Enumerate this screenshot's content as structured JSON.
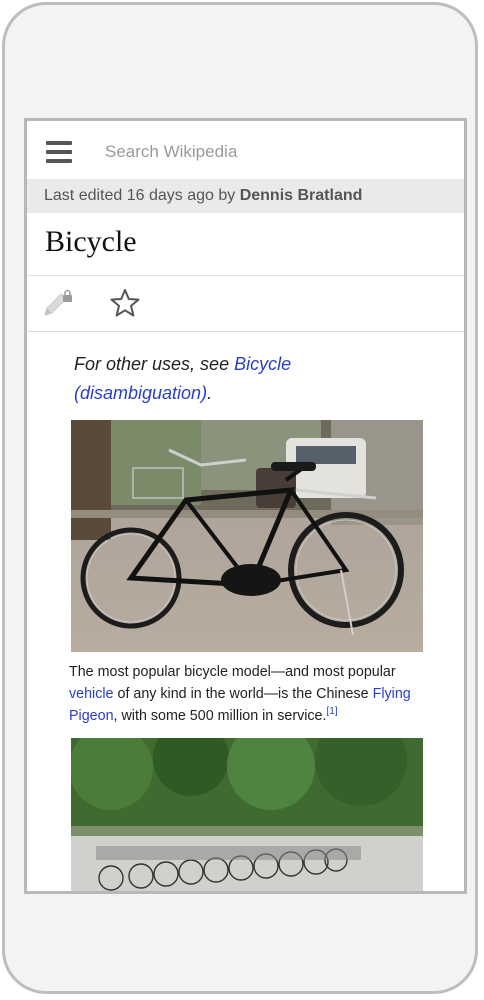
{
  "search": {
    "placeholder": "Search Wikipedia"
  },
  "edited": {
    "prefix": "Last edited 16 days ago by ",
    "author": "Dennis Bratland"
  },
  "article": {
    "title": "Bicycle",
    "hatnote": {
      "prefix": "For other uses, see ",
      "link": "Bicycle (disambiguation)",
      "suffix": "."
    },
    "caption": {
      "part1": "The most popular bicycle model—and most popular ",
      "link1": "vehicle",
      "part2": " of any kind in the world—is the Chinese ",
      "link2": "Flying Pigeon",
      "part3": ", with some 500 million in service.",
      "ref": "[1]"
    }
  },
  "icons": {
    "menu": "hamburger-menu-icon",
    "edit": "pencil-lock-icon",
    "watch": "star-icon"
  },
  "colors": {
    "link": "#2a3fc7",
    "edited_bar": "#eaeaea"
  }
}
